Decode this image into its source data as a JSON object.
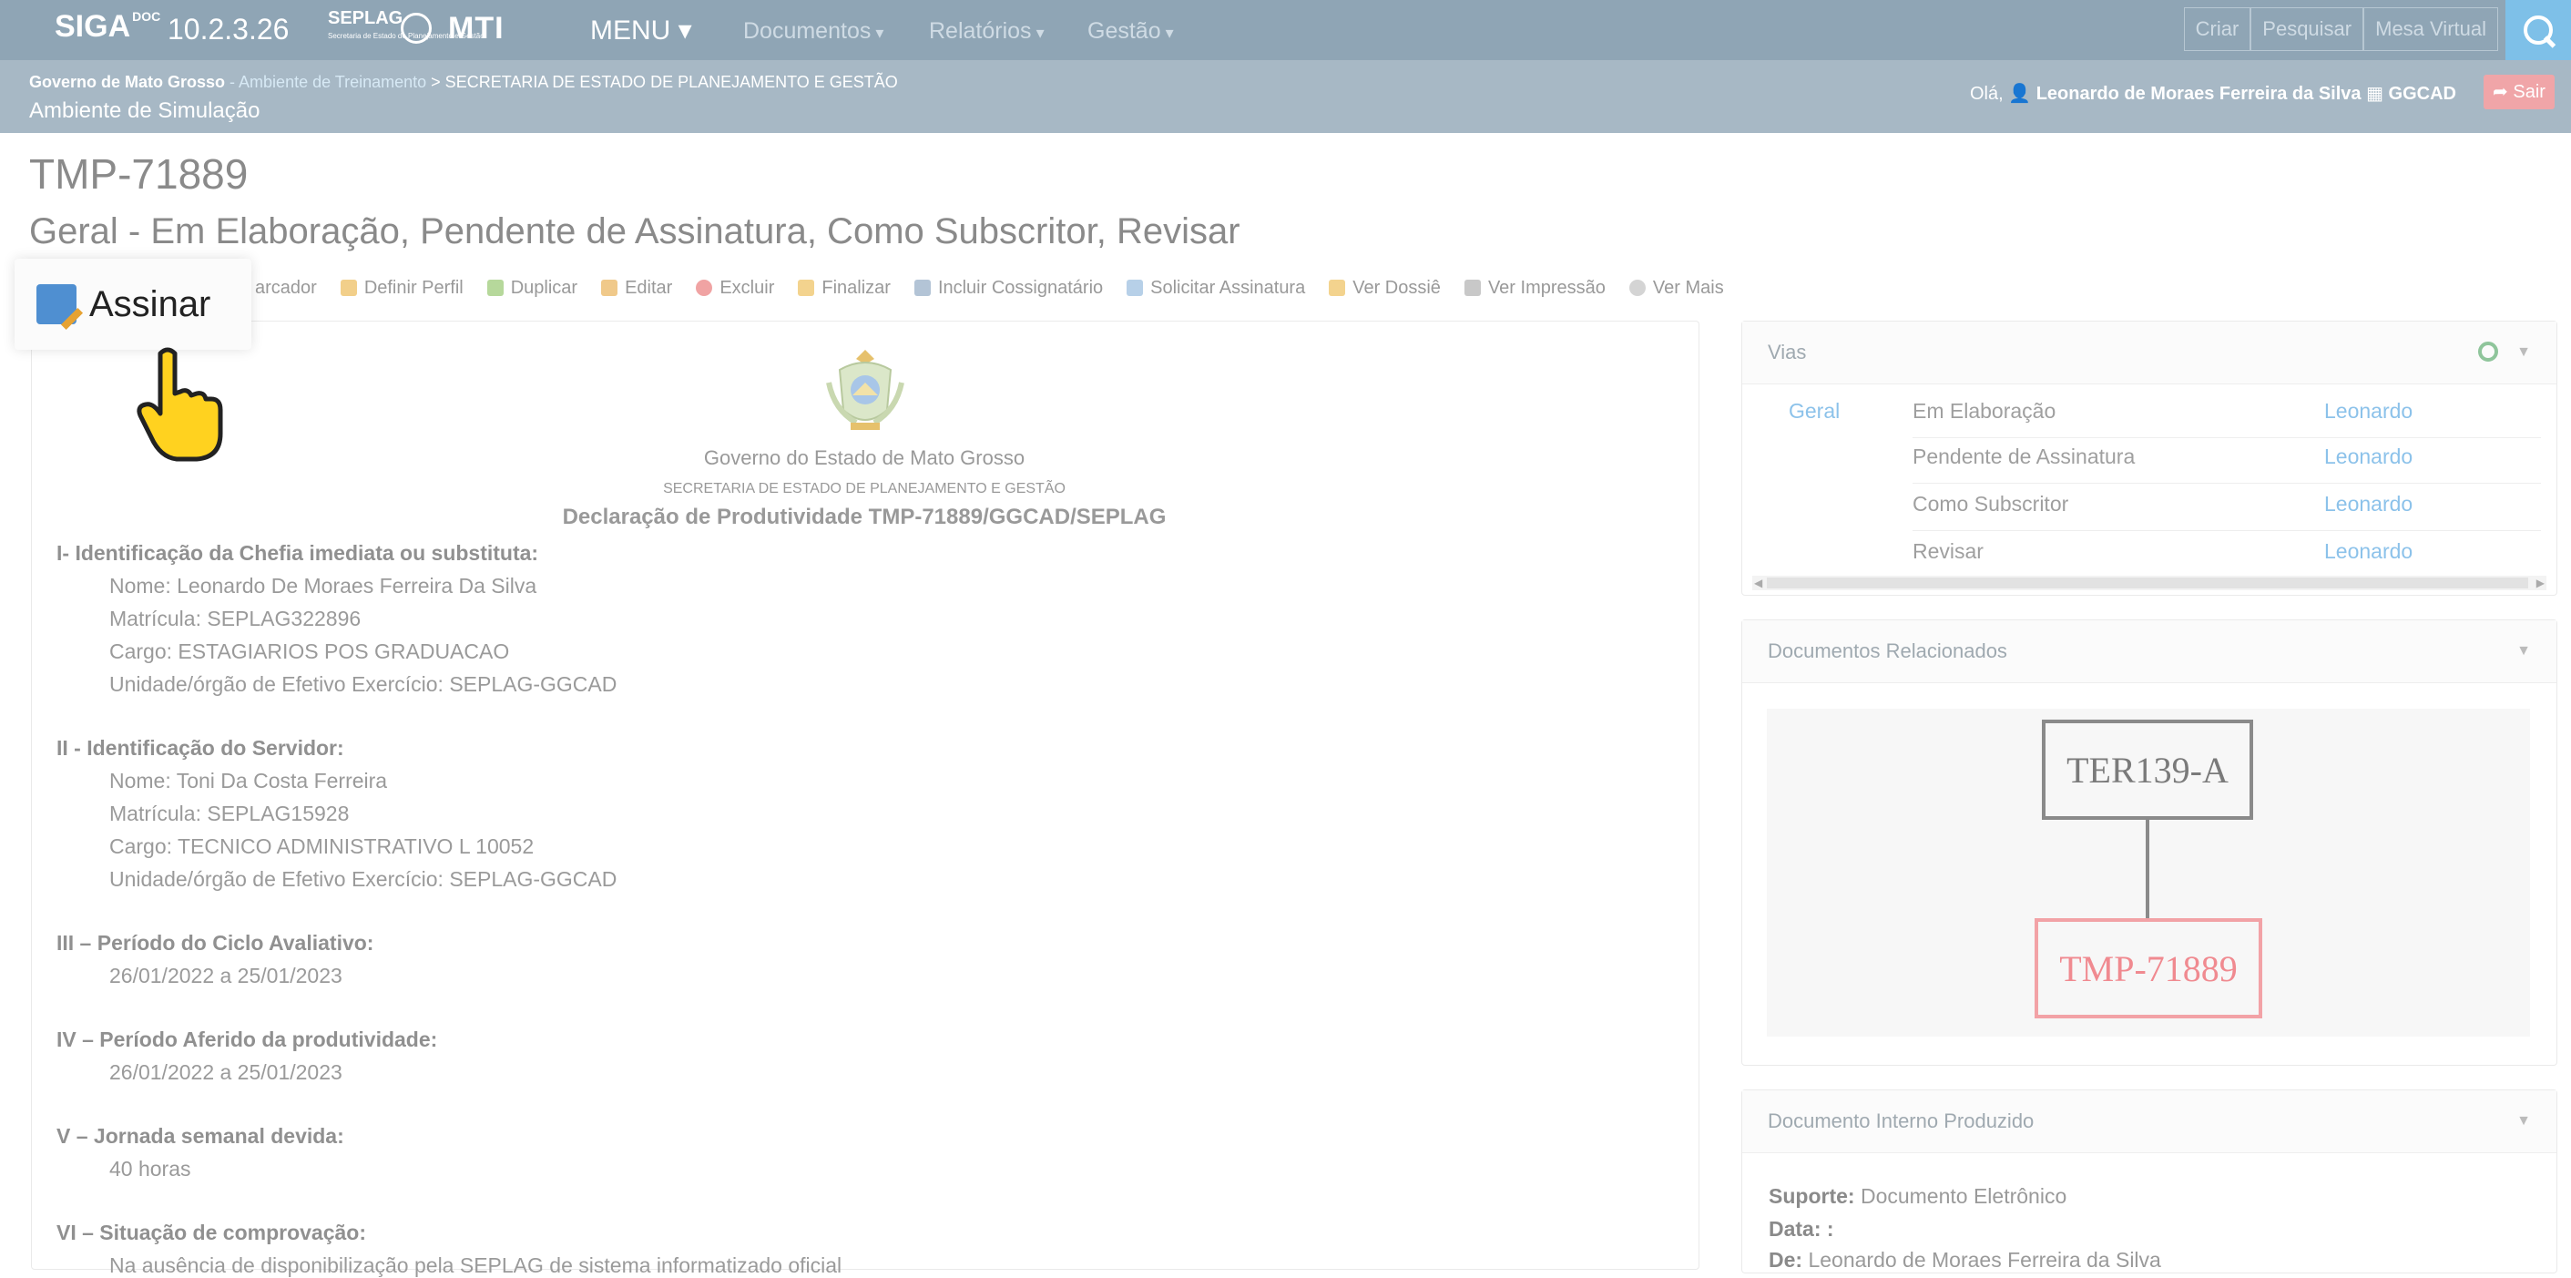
{
  "topnav": {
    "brand": "SIGA",
    "brand_sup": "DOC",
    "version": "10.2.3.26",
    "seplag": "SEPLAG",
    "seplag_sub": "Secretaria de Estado de Planejamento e Gestão",
    "mti": "MTI",
    "menu": "MENU ▾",
    "items": [
      "Documentos",
      "Relatórios",
      "Gestão"
    ],
    "right": [
      "Criar",
      "Pesquisar",
      "Mesa Virtual"
    ]
  },
  "subbar": {
    "org": "Governo de Mato Grosso",
    "env": " - Ambiente de Treinamento",
    "unit": " > SECRETARIA DE ESTADO DE PLANEJAMENTO E GESTÃO",
    "sim": "Ambiente de Simulação",
    "hello_prefix": "Olá, ",
    "user": "Leonardo de Moraes Ferreira da Silva",
    "lotacao": "GGCAD",
    "logout": "Sair"
  },
  "document": {
    "code": "TMP-71889",
    "status": "Geral - Em Elaboração, Pendente de Assinatura, Como Subscritor, Revisar"
  },
  "toolbar": {
    "items": [
      "arcador",
      "Definir Perfil",
      "Duplicar",
      "Editar",
      "Excluir",
      "Finalizar",
      "Incluir Cossignatário",
      "Solicitar Assinatura",
      "Ver Dossiê",
      "Ver Impressão",
      "Ver Mais"
    ],
    "popup_label": "Assinar"
  },
  "content": {
    "gov": "Governo do Estado de Mato Grosso",
    "sec": "SECRETARIA DE ESTADO DE PLANEJAMENTO E GESTÃO",
    "title": "Declaração de Produtividade TMP-71889/GGCAD/SEPLAG",
    "lines": [
      "I- Identificação da Chefia imediata ou substituta:",
      "Nome: Leonardo De Moraes Ferreira Da Silva",
      "Matrícula: SEPLAG322896",
      "Cargo: ESTAGIARIOS POS GRADUACAO",
      "Unidade/órgão de Efetivo Exercício: SEPLAG-GGCAD",
      "II - Identificação do Servidor:",
      "Nome: Toni Da Costa Ferreira",
      "Matrícula: SEPLAG15928",
      "Cargo: TECNICO ADMINISTRATIVO L 10052",
      "Unidade/órgão de Efetivo Exercício: SEPLAG-GGCAD",
      "III – Período do Ciclo Avaliativo:",
      "26/01/2022 a 25/01/2023",
      "IV – Período Aferido da produtividade:",
      "26/01/2022 a 25/01/2023",
      "V – Jornada semanal devida:",
      "40 horas",
      "VI – Situação de comprovação:",
      "Na ausência de disponibilização pela SEPLAG de sistema informatizado oficial"
    ]
  },
  "vias": {
    "title": "Vias",
    "via": "Geral",
    "rows": [
      {
        "status": "Em Elaboração",
        "who": "Leonardo"
      },
      {
        "status": "Pendente de Assinatura",
        "who": "Leonardo"
      },
      {
        "status": "Como Subscritor",
        "who": "Leonardo"
      },
      {
        "status": "Revisar",
        "who": "Leonardo"
      }
    ]
  },
  "related": {
    "title": "Documentos Relacionados",
    "parent": "TER139-A",
    "child": "TMP-71889"
  },
  "internal": {
    "title": "Documento Interno Produzido",
    "suporte_label": "Suporte:",
    "suporte": " Documento Eletrônico",
    "data_label": "Data: :",
    "de_label": "De:",
    "de": " Leonardo de Moraes Ferreira da Silva"
  }
}
